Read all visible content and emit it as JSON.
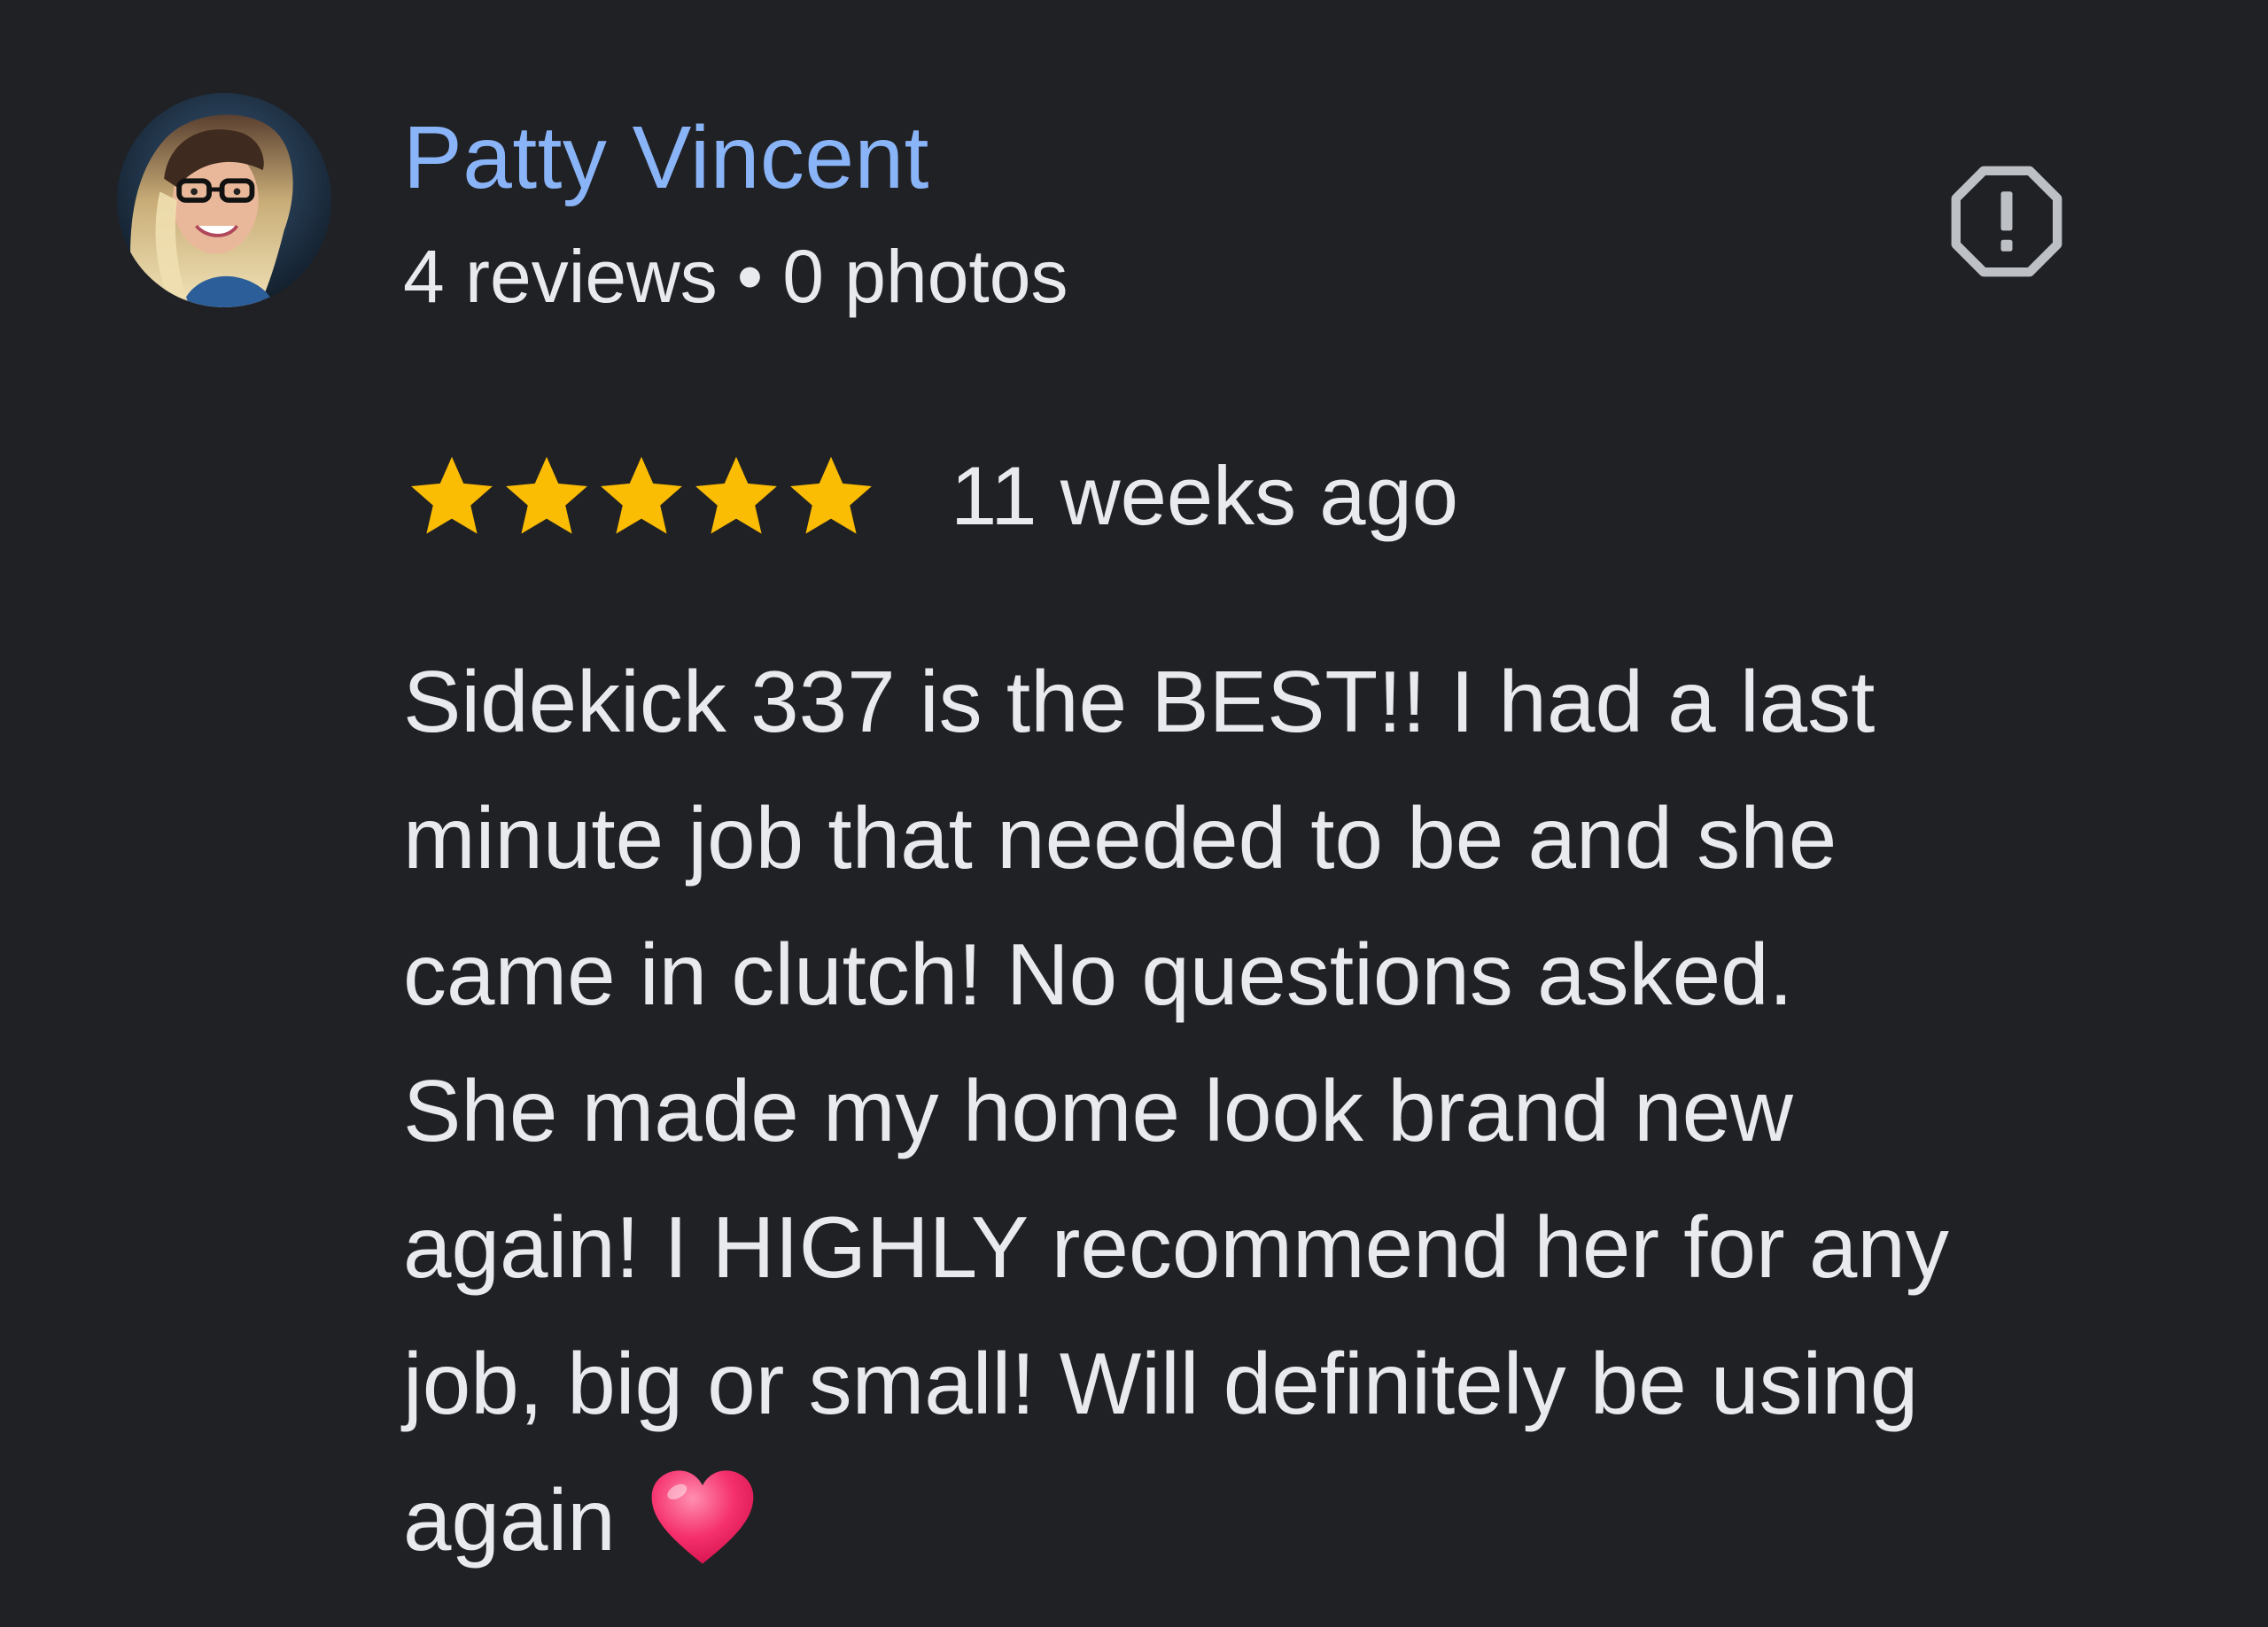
{
  "review": {
    "author": {
      "name": "Patty Vincent",
      "reviews_count": "4 reviews",
      "separator": "•",
      "photos_count": "0 photos",
      "avatar_icon": "user-photo-avatar"
    },
    "report_icon": "report-octagon-exclamation-icon",
    "rating": {
      "stars": 5,
      "max_stars": 5,
      "star_color": "#fbbc04",
      "time": "11 weeks ago"
    },
    "text_lines": [
      "Sidekick 337 is the BEST!! I had a last",
      "minute job that needed to be and she",
      "came in clutch! No questions asked.",
      "She made my home look brand new",
      "again! I HIGHLY recommend her for any",
      "job, big or small! Will definitely be using",
      "again"
    ],
    "emoji": "heart-emoji"
  },
  "colors": {
    "background": "#202124",
    "name": "#8ab4f8",
    "text": "#e8eaed",
    "icon": "#bdc1c6"
  }
}
